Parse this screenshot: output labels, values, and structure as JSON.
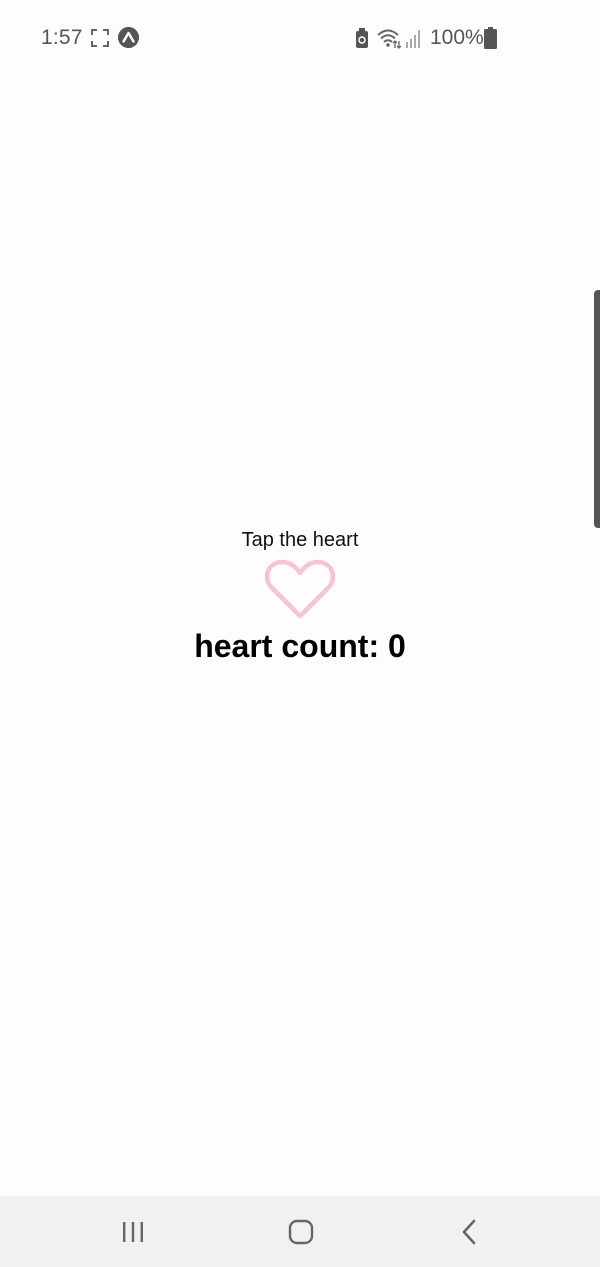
{
  "status_bar": {
    "time": "1:57",
    "battery_percent": "100%",
    "icons": [
      "screenshot-icon",
      "expo-icon",
      "usb-icon",
      "wifi-icon",
      "signal-icon",
      "battery-icon"
    ]
  },
  "main": {
    "prompt": "Tap the heart",
    "heart_icon": "heart-outline-icon",
    "heart_color": "#f5c6d2",
    "heart_count_text": "heart count: 0"
  },
  "nav_bar": {
    "buttons": [
      "recents-icon",
      "home-icon",
      "back-icon"
    ]
  }
}
